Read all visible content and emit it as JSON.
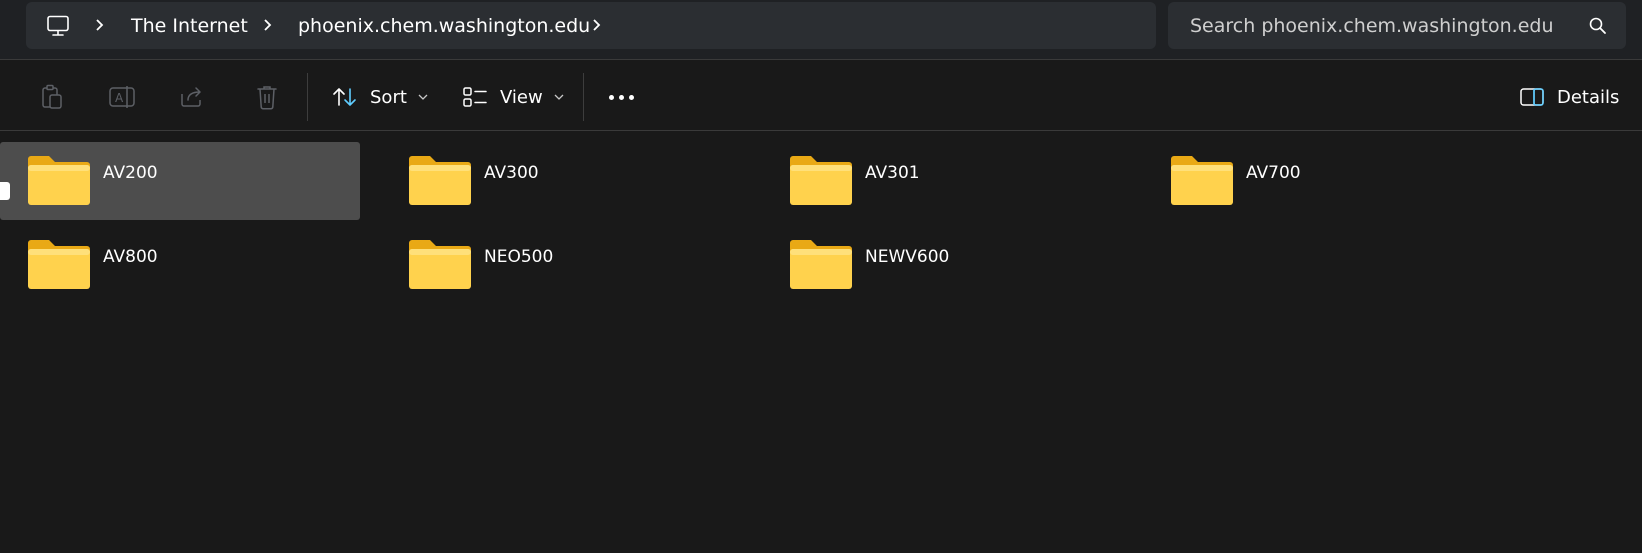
{
  "address_bar": {
    "breadcrumb": [
      "The Internet",
      "phoenix.chem.washington.edu"
    ],
    "search_placeholder": "Search phoenix.chem.washington.edu"
  },
  "toolbar": {
    "sort_label": "Sort",
    "view_label": "View",
    "details_label": "Details"
  },
  "folders": [
    {
      "name": "AV200",
      "selected": true
    },
    {
      "name": "AV300",
      "selected": false
    },
    {
      "name": "AV301",
      "selected": false
    },
    {
      "name": "AV700",
      "selected": false
    },
    {
      "name": "AV800",
      "selected": false
    },
    {
      "name": "NEO500",
      "selected": false
    },
    {
      "name": "NEWV600",
      "selected": false
    }
  ],
  "colors": {
    "background": "#191919",
    "selection": "#4d4d4d",
    "folder_yellow": "#ffd24d",
    "folder_tab": "#f4b41a",
    "accent_blue": "#60cdff"
  },
  "icons": {
    "home": "this-pc-icon",
    "search": "search-icon",
    "copy": "copy-icon",
    "rename": "rename-icon",
    "share": "share-icon",
    "delete": "trash-icon",
    "sort": "sort-icon",
    "view": "view-icon",
    "more": "more-icon",
    "details": "details-pane-icon",
    "folder": "folder-icon"
  }
}
